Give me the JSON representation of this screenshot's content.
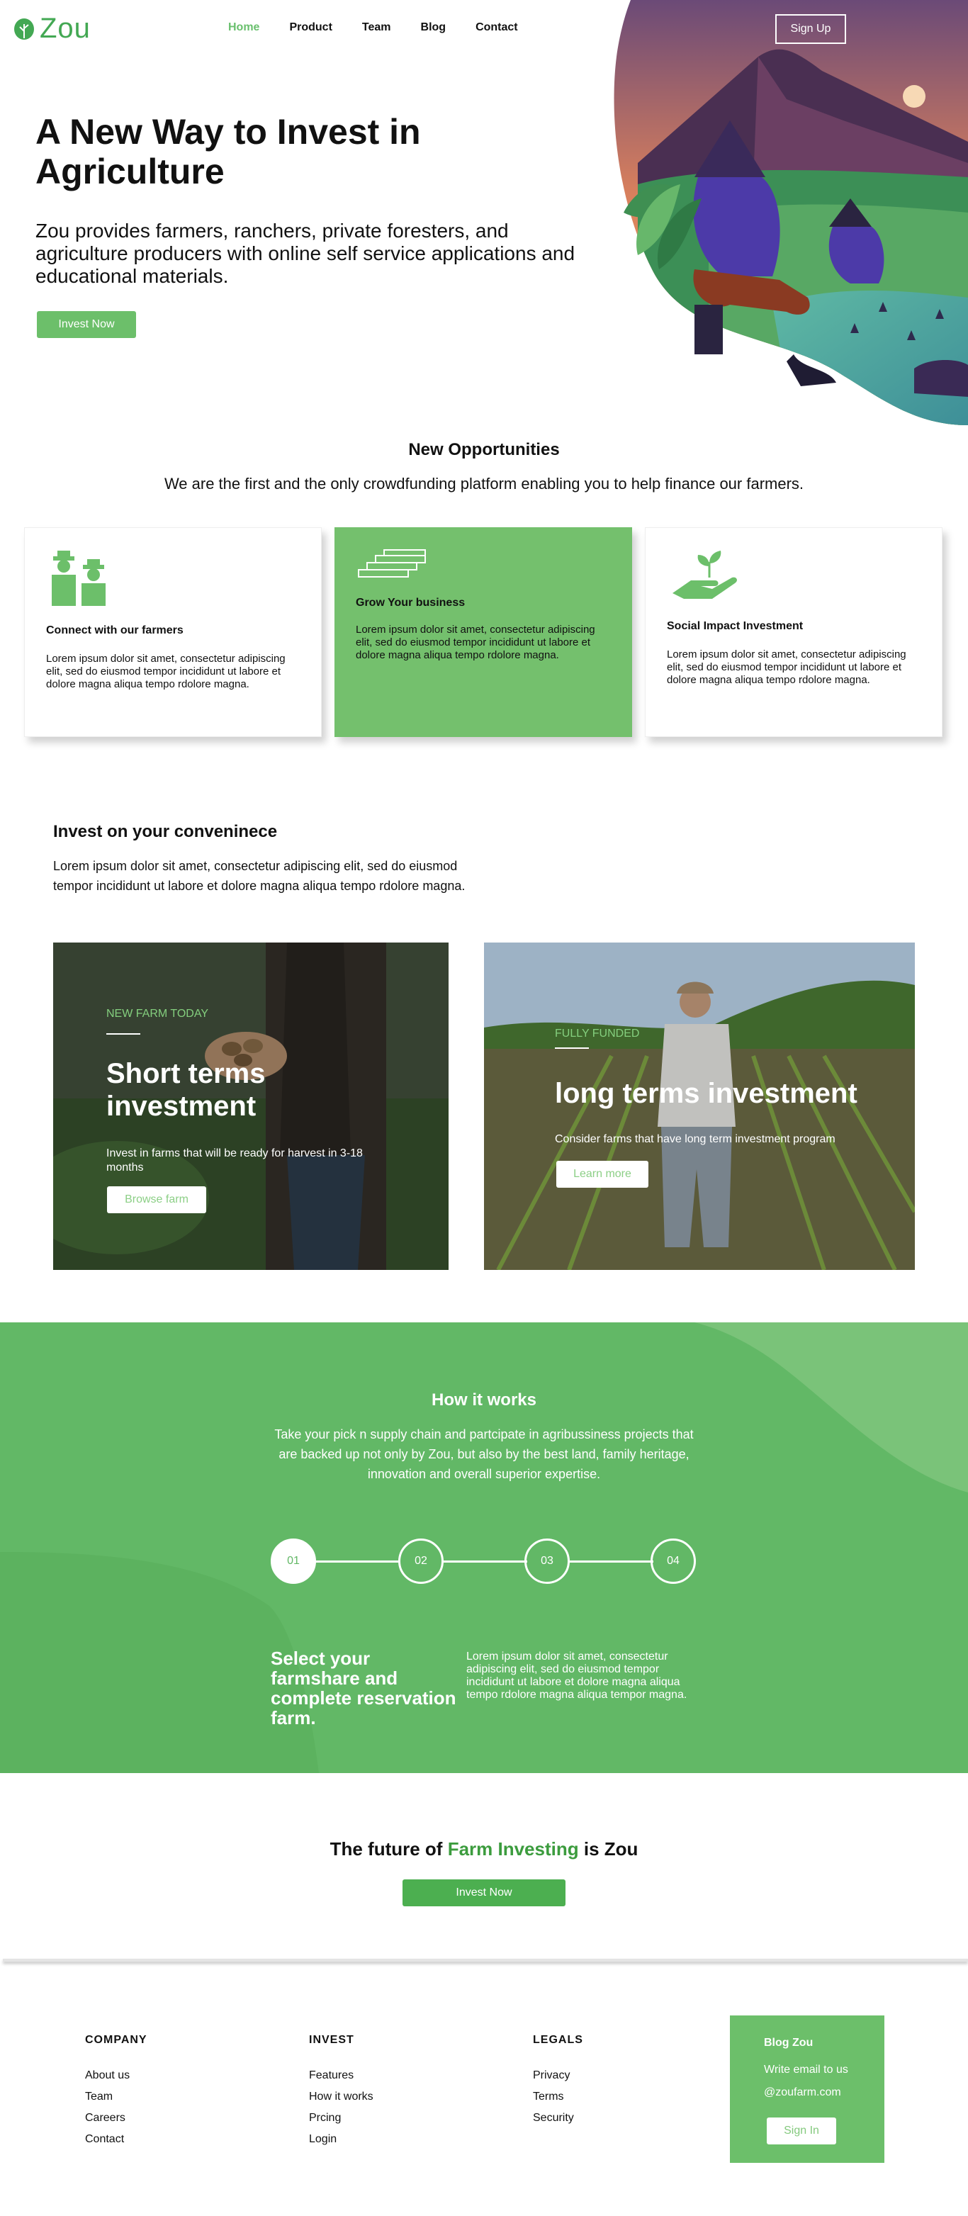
{
  "brand": {
    "name": "Zou",
    "color": "#43a853"
  },
  "nav": {
    "items": [
      "Home",
      "Product",
      "Team",
      "Blog",
      "Contact"
    ],
    "active": "Home",
    "signup": "Sign Up"
  },
  "hero": {
    "title": "A New Way to Invest in Agriculture",
    "subtitle": "Zou provides farmers, ranchers, private foresters, and agriculture producers with online self service applications and educational materials.",
    "cta": "Invest Now"
  },
  "opportunities": {
    "title": "New Opportunities",
    "subtitle": "We are the first and the only crowdfunding platform enabling you to help finance our farmers.",
    "cards": [
      {
        "icon": "farmers-icon",
        "title": "Connect with our farmers",
        "body": "Lorem ipsum dolor sit amet, consectetur adipiscing elit, sed do eiusmod tempor incididunt ut labore et dolore magna aliqua tempo rdolore magna."
      },
      {
        "icon": "stairs-icon",
        "title": "Grow Your business",
        "body": "Lorem ipsum dolor sit amet, consectetur adipiscing elit, sed do eiusmod tempor incididunt ut labore et dolore magna aliqua tempo rdolore magna."
      },
      {
        "icon": "plant-hand-icon",
        "title": "Social Impact Investment",
        "body": "Lorem ipsum dolor sit amet, consectetur adipiscing elit, sed do eiusmod tempor incididunt ut labore et dolore magna aliqua tempo rdolore magna."
      }
    ]
  },
  "invest": {
    "title": "Invest on your conveninece",
    "body": "Lorem ipsum dolor sit amet, consectetur adipiscing elit, sed do eiusmod tempor incididunt ut labore et dolore magna aliqua tempo rdolore magna.",
    "tiles": [
      {
        "tag": "NEW FARM TODAY",
        "title": "Short terms investment",
        "body": "Invest in farms that will be ready for harvest in 3-18 months",
        "button": "Browse farm"
      },
      {
        "tag": "FULLY FUNDED",
        "title": "long terms investment",
        "body": "Consider farms that have long term investment program",
        "button": "Learn more"
      }
    ]
  },
  "how": {
    "title": "How it works",
    "body": "Take your pick n supply chain and partcipate in agribussiness projects that are backed up not only by Zou, but also by the best land, family heritage, innovation and overall superior expertise.",
    "steps": [
      "01",
      "02",
      "03",
      "04"
    ],
    "active_step": "01",
    "heading": "Select your farmshare and complete reservation farm.",
    "text": "Lorem ipsum dolor sit amet, consectetur adipiscing elit, sed do eiusmod tempor incididunt ut labore et dolore magna aliqua tempo rdolore magna aliqua tempor magna."
  },
  "future": {
    "prefix": "The future of ",
    "highlight": "Farm Investing",
    "suffix": " is Zou",
    "cta": "Invest Now"
  },
  "footer": {
    "company": {
      "heading": "COMPANY",
      "links": [
        "About us",
        "Team",
        "Careers",
        "Contact"
      ]
    },
    "invest": {
      "heading": "INVEST",
      "links": [
        "Features",
        "How it works",
        "Prcing",
        "Login"
      ]
    },
    "legals": {
      "heading": "LEGALS",
      "links": [
        "Privacy",
        "Terms",
        "Security"
      ]
    },
    "blog": {
      "heading": "Blog Zou",
      "line1": "Write email to us",
      "line2": "@zoufarm.com",
      "button": "Sign In"
    }
  },
  "colors": {
    "accent": "#6cbf6a",
    "section_green": "#62b866",
    "highlight": "#3c9c3e"
  }
}
